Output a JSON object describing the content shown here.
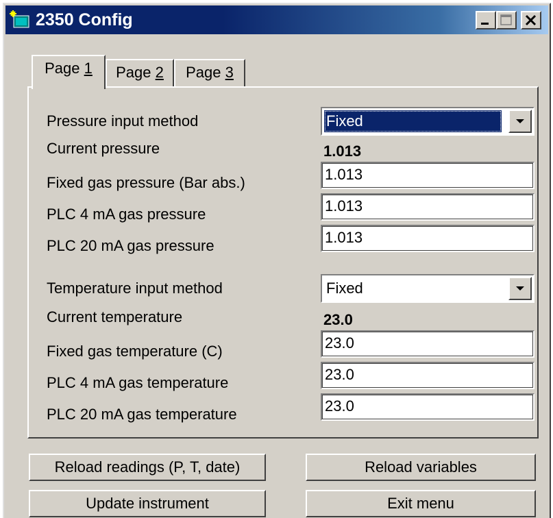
{
  "window": {
    "title": "2350 Config",
    "controls": [
      "minimize-icon",
      "maximize-icon",
      "close-icon"
    ]
  },
  "tabs": [
    {
      "prefix": "Page ",
      "key": "1",
      "active": true
    },
    {
      "prefix": "Page ",
      "key": "2",
      "active": false
    },
    {
      "prefix": "Page ",
      "key": "3",
      "active": false
    }
  ],
  "pressure": {
    "method_label": "Pressure input method",
    "method_value": "Fixed",
    "current_label": "Current pressure",
    "current_value": "1.013",
    "fixed_label": "Fixed gas pressure (Bar abs.)",
    "fixed_value": "1.013",
    "plc4_label": "PLC 4 mA gas pressure",
    "plc4_value": "1.013",
    "plc20_label": "PLC 20 mA gas pressure",
    "plc20_value": "1.013"
  },
  "temperature": {
    "method_label": "Temperature input method",
    "method_value": "Fixed",
    "current_label": "Current temperature",
    "current_value": "23.0",
    "fixed_label": "Fixed gas temperature (C)",
    "fixed_value": "23.0",
    "plc4_label": "PLC 4 mA gas temperature",
    "plc4_value": "23.0",
    "plc20_label": "PLC 20 mA gas temperature",
    "plc20_value": "23.0"
  },
  "buttons": {
    "reload_readings": "Reload readings (P, T, date)",
    "reload_variables": "Reload variables",
    "update_instrument": "Update instrument",
    "exit_menu": "Exit menu"
  },
  "colors": {
    "titlebar": "#0a246a",
    "face": "#d4d0c8",
    "selection": "#0a246a"
  }
}
